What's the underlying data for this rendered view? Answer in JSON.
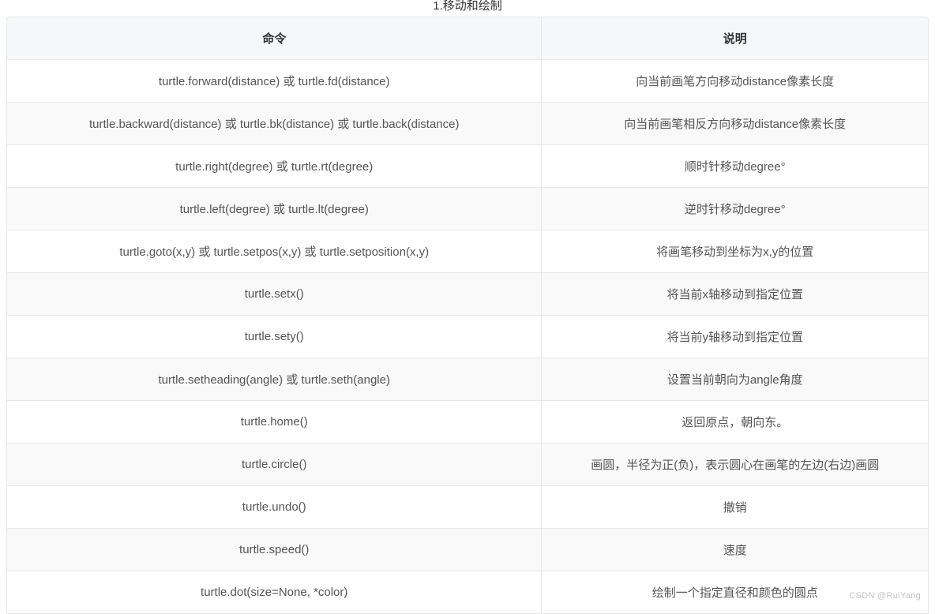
{
  "title": "1.移动和绘制",
  "headers": {
    "command": "命令",
    "description": "说明"
  },
  "rows": [
    {
      "command": "turtle.forward(distance) 或 turtle.fd(distance)",
      "description": "向当前画笔方向移动distance像素长度"
    },
    {
      "command": "turtle.backward(distance) 或 turtle.bk(distance) 或 turtle.back(distance)",
      "description": "向当前画笔相反方向移动distance像素长度"
    },
    {
      "command": "turtle.right(degree) 或 turtle.rt(degree)",
      "description": "顺时针移动degree°"
    },
    {
      "command": "turtle.left(degree) 或 turtle.lt(degree)",
      "description": "逆时针移动degree°"
    },
    {
      "command": "turtle.goto(x,y) 或 turtle.setpos(x,y) 或 turtle.setposition(x,y)",
      "description": "将画笔移动到坐标为x,y的位置"
    },
    {
      "command": "turtle.setx()",
      "description": "将当前x轴移动到指定位置"
    },
    {
      "command": "turtle.sety()",
      "description": "将当前y轴移动到指定位置"
    },
    {
      "command": "turtle.setheading(angle) 或 turtle.seth(angle)",
      "description": "设置当前朝向为angle角度"
    },
    {
      "command": "turtle.home()",
      "description": "返回原点，朝向东。"
    },
    {
      "command": "turtle.circle()",
      "description": "画圆，半径为正(负)，表示圆心在画笔的左边(右边)画圆"
    },
    {
      "command": "turtle.undo()",
      "description": "撤销"
    },
    {
      "command": "turtle.speed()",
      "description": "速度"
    },
    {
      "command": "turtle.dot(size=None, *color)",
      "description": "绘制一个指定直径和颜色的圆点"
    }
  ],
  "watermark": "CSDN @RuiYang"
}
